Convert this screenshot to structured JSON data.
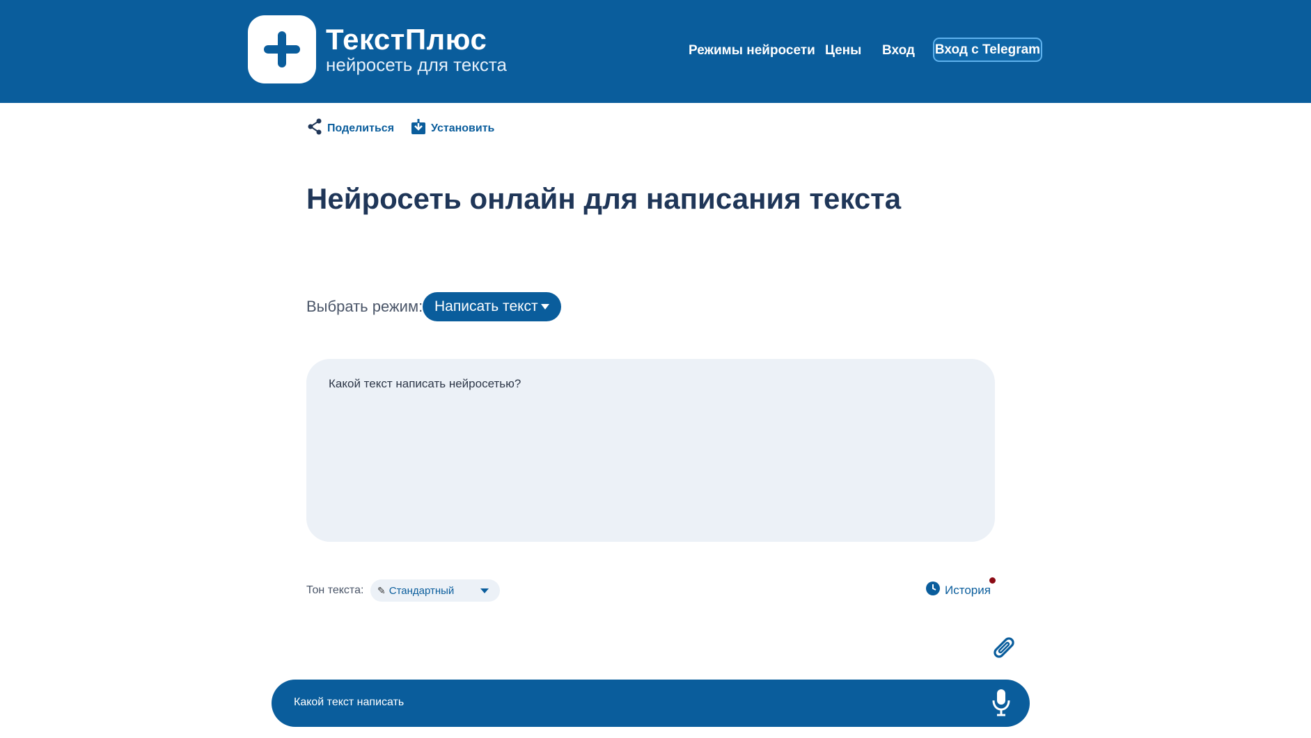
{
  "header": {
    "brand_title": "ТекстПлюс",
    "brand_subtitle": "нейросеть для текста",
    "nav": {
      "modes": "Режимы нейросети",
      "prices": "Цены",
      "login": "Вход",
      "telegram_login": "Вход с Telegram"
    },
    "background_color": "#0a5d9c"
  },
  "toolbar": {
    "share_label": "Поделиться",
    "install_label": "Установить"
  },
  "main": {
    "title": "Нейросеть онлайн для написания текста",
    "mode_label": "Выбрать режим:",
    "mode_selected": "Написать текст",
    "textarea_placeholder": "Какой текст написать нейросетью?",
    "tone_label": "Тон текста:",
    "tone_selected": "Стандартный",
    "history_label": "История"
  },
  "bottom_bar": {
    "placeholder": "Какой текст написать"
  },
  "icons": [
    "plus-icon",
    "share-icon",
    "install-icon",
    "chevron-down-icon",
    "clock-icon",
    "paperclip-icon",
    "microphone-icon"
  ],
  "colors": {
    "primary": "#0a5d9c",
    "input_bg": "#ecf1f7",
    "notification_dot": "#8b0a14"
  }
}
